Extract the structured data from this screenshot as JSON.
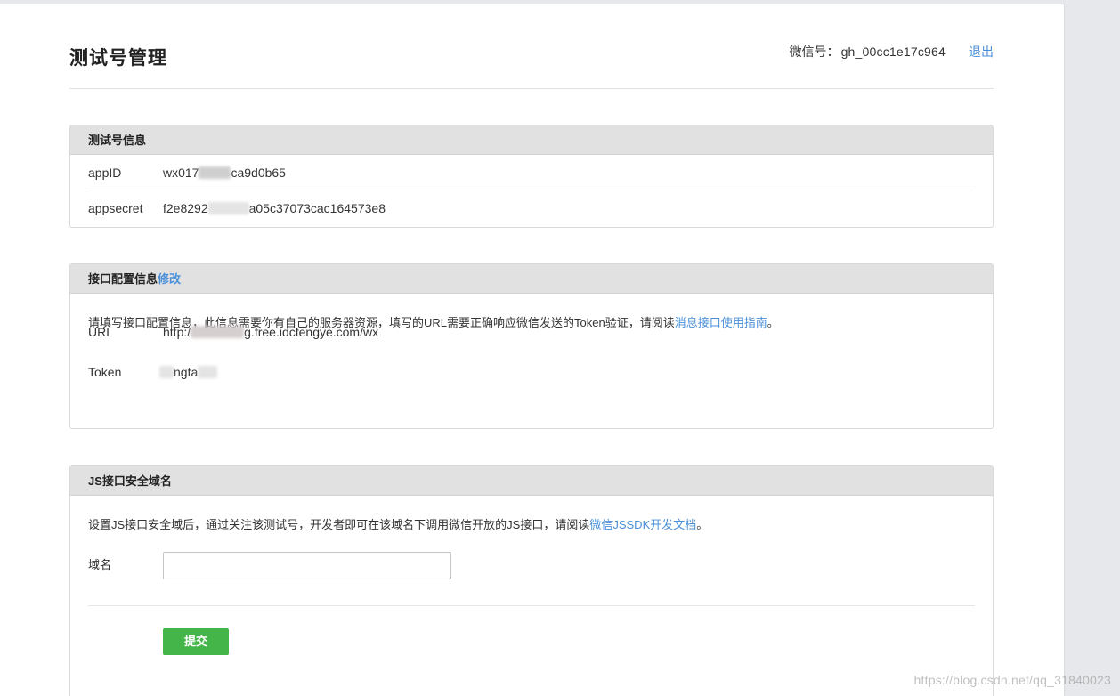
{
  "header": {
    "title": "测试号管理",
    "account_label": "微信号：",
    "account_value": "gh_00cc1e17c964",
    "logout": "退出"
  },
  "test_info": {
    "title": "测试号信息",
    "appid_label": "appID",
    "appid_prefix": "wx017",
    "appid_suffix": "ca9d0b65",
    "appsecret_label": "appsecret",
    "appsecret_prefix": "f2e8292",
    "appsecret_suffix": "a05c37073cac164573e8"
  },
  "interface_config": {
    "title": "接口配置信息",
    "edit_link": "修改",
    "desc": "请填写接口配置信息，此信息需要你有自己的服务器资源，填写的URL需要正确响应微信发送的Token验证，请阅读",
    "desc_link": "消息接口使用指南",
    "desc_end": "。",
    "url_label": "URL",
    "url_prefix": "http:/",
    "url_suffix": "g.free.idcfengye.com/wx",
    "token_label": "Token",
    "token_visible": "ngta"
  },
  "js_domain": {
    "title": "JS接口安全域名",
    "desc": "设置JS接口安全域后，通过关注该测试号，开发者即可在该域名下调用微信开放的JS接口，请阅读",
    "desc_link": "微信JSSDK开发文档",
    "desc_end": "。",
    "domain_label": "域名",
    "domain_value": "",
    "submit": "提交"
  },
  "watermark": "https://blog.csdn.net/qq_31840023",
  "colors": {
    "link": "#4a90d9",
    "submit_bg": "#44b549",
    "panel_head_bg": "#e1e1e1"
  }
}
